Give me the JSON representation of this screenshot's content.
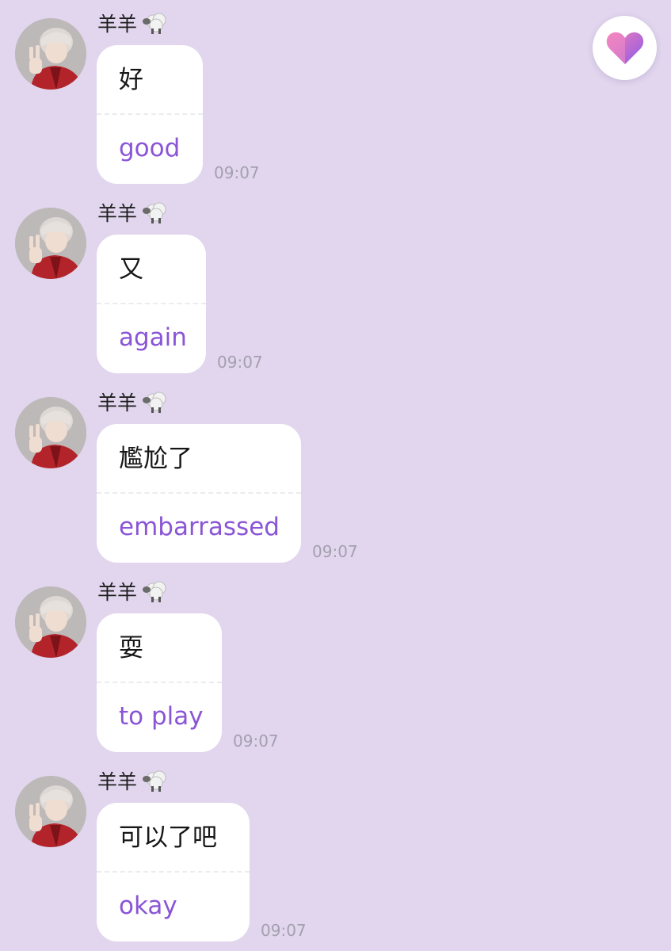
{
  "theme": {
    "background": "#e1d6ee",
    "bubble": "#ffffff",
    "translation_color": "#8a55d6",
    "timestamp_color": "#a49fae"
  },
  "favorite_button": {
    "icon": "heart-icon"
  },
  "messages": [
    {
      "sender": "羊羊",
      "sender_icon": "sheep-icon",
      "original": "好",
      "translation": "good",
      "time": "09:07"
    },
    {
      "sender": "羊羊",
      "sender_icon": "sheep-icon",
      "original": "又",
      "translation": "again",
      "time": "09:07"
    },
    {
      "sender": "羊羊",
      "sender_icon": "sheep-icon",
      "original": "尷尬了",
      "translation": "embarrassed",
      "time": "09:07"
    },
    {
      "sender": "羊羊",
      "sender_icon": "sheep-icon",
      "original": "耍",
      "translation": "to play",
      "time": "09:07"
    },
    {
      "sender": "羊羊",
      "sender_icon": "sheep-icon",
      "original": "可以了吧",
      "translation": "okay",
      "time": "09:07"
    }
  ]
}
